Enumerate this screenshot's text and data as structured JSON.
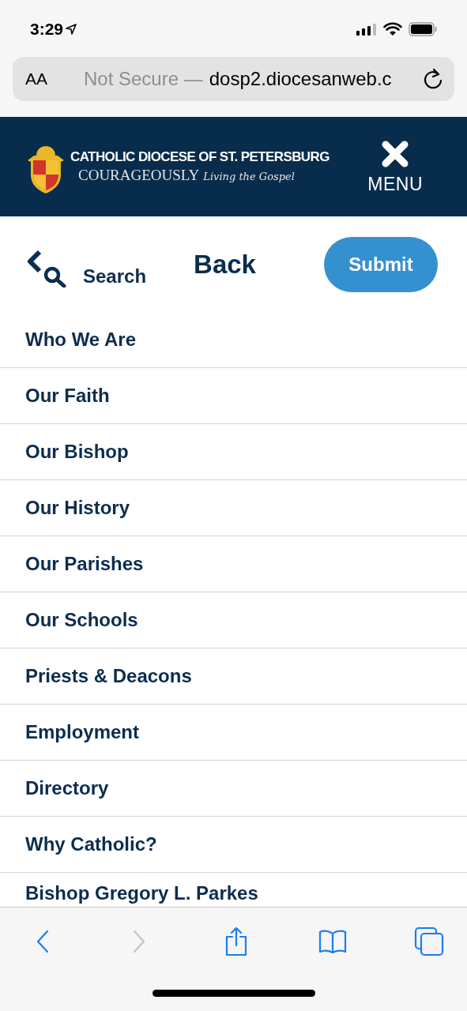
{
  "status_bar": {
    "time": "3:29"
  },
  "address_bar": {
    "text_size_button": "AA",
    "security": "Not Secure —",
    "url": "dosp2.diocesanweb.c"
  },
  "header": {
    "title": "CATHOLIC DIOCESE OF ST. PETERSBURG",
    "motto": "COURAGEOUSLY",
    "tagline": "Living the Gospel",
    "menu_label": "MENU"
  },
  "actions": {
    "search": "Search",
    "back": "Back",
    "submit": "Submit"
  },
  "menu_items": [
    {
      "label": "Who We Are"
    },
    {
      "label": "Our Faith"
    },
    {
      "label": "Our Bishop"
    },
    {
      "label": "Our History"
    },
    {
      "label": "Our Parishes"
    },
    {
      "label": "Our Schools"
    },
    {
      "label": "Priests & Deacons"
    },
    {
      "label": "Employment"
    },
    {
      "label": "Directory"
    },
    {
      "label": "Why Catholic?"
    },
    {
      "label": "Bishop Gregory L. Parkes"
    }
  ],
  "toolbar": [
    {
      "kind": "back",
      "disabled": false
    },
    {
      "kind": "forward",
      "disabled": true
    },
    {
      "kind": "share",
      "disabled": false
    },
    {
      "kind": "bookmarks",
      "disabled": false
    },
    {
      "kind": "tabs",
      "disabled": false
    }
  ]
}
